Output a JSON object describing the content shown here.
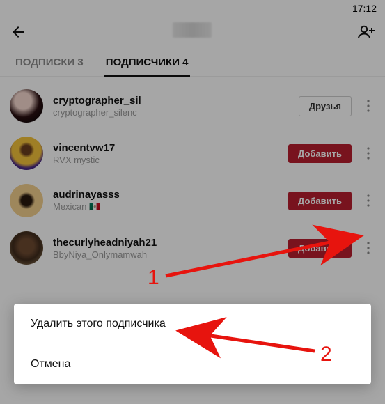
{
  "status": {
    "time": "17:12"
  },
  "header": {
    "title": ""
  },
  "tabs": {
    "subscriptions": {
      "label": "ПОДПИСКИ 3"
    },
    "subscribers": {
      "label": "ПОДПИСЧИКИ 4",
      "active": true
    }
  },
  "buttons": {
    "friends": "Друзья",
    "add": "Добавить"
  },
  "followers": [
    {
      "username": "cryptographer_sil",
      "subtitle": "cryptographer_silenc",
      "action": "friends",
      "avatar": {
        "bg": "radial-gradient(circle at 40% 35%, #f6d9d0 0 28%, #2a1012 55%, #000 100%)"
      }
    },
    {
      "username": "vincentvw17",
      "subtitle": "RVX mystic",
      "action": "add",
      "avatar": {
        "bg": "radial-gradient(circle at 50% 40%, #6b3e1e 0 18%, #f5c33b 30% 55%, #4b2a88 70%, #2b1750 100%)"
      }
    },
    {
      "username": "audrinayasss",
      "subtitle": "Mexican 🇲🇽",
      "action": "add",
      "avatar": {
        "bg": "radial-gradient(circle at 50% 50%, #2a1a0e 0 22%, #f3cf8e 36% 70%, #b78a3d 100%)"
      }
    },
    {
      "username": "thecurlyheadniyah21",
      "subtitle": "BbyNiya_Onlymamwah",
      "action": "add",
      "avatar": {
        "bg": "radial-gradient(circle at 50% 45%, #6d4a31 0 30%, #3f2b1c 55%, #a08860 100%)"
      }
    }
  ],
  "sheet": {
    "delete": "Удалить этого подписчика",
    "cancel": "Отмена"
  },
  "annotations": {
    "one": "1",
    "two": "2"
  }
}
